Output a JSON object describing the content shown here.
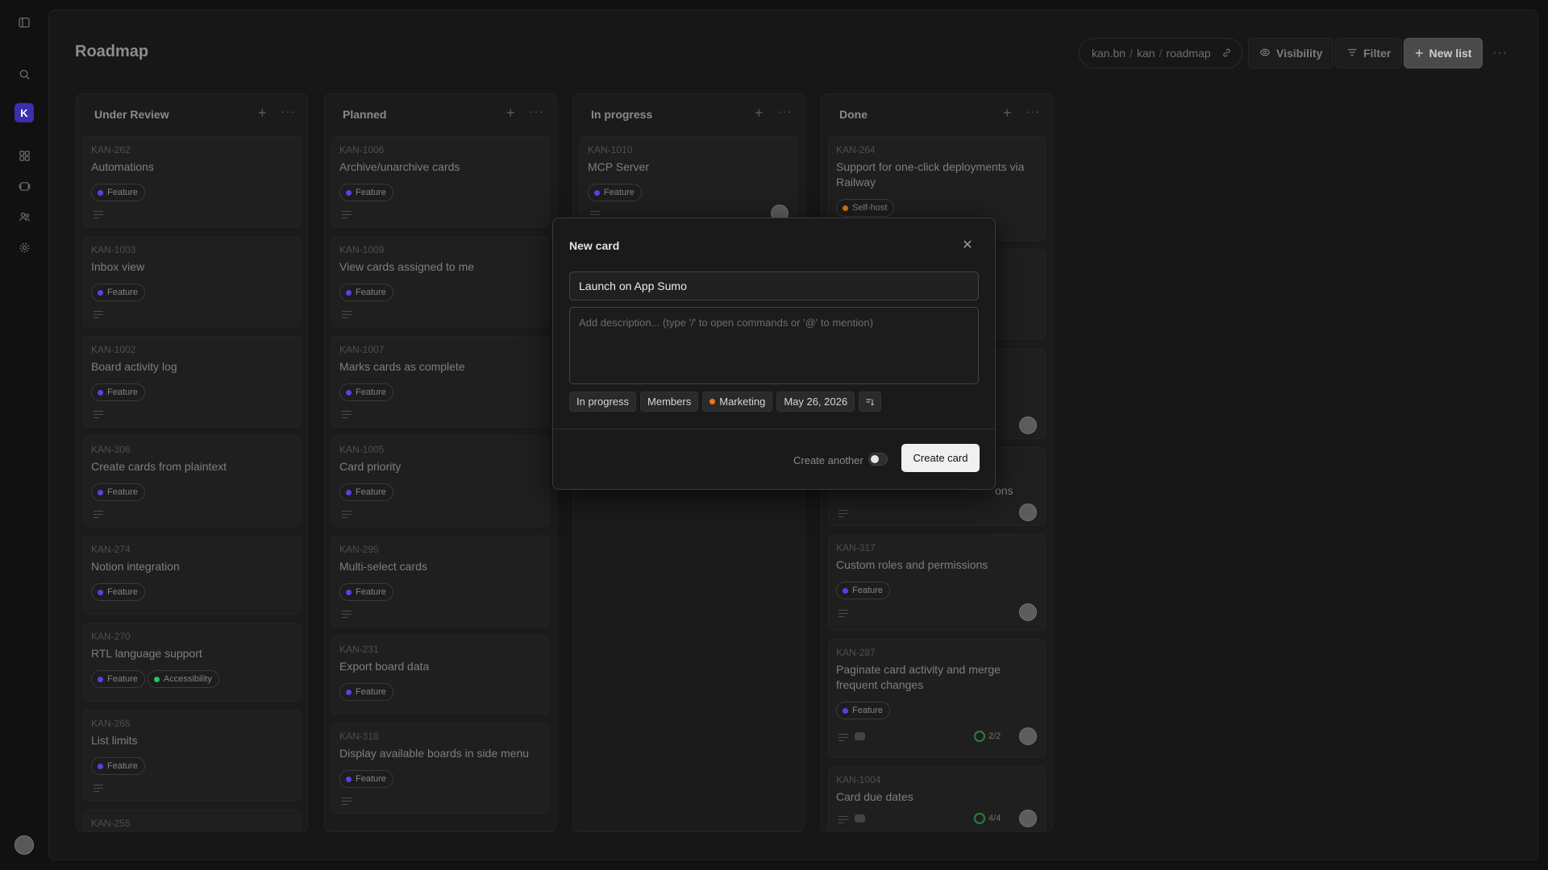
{
  "page": {
    "title": "Roadmap"
  },
  "breadcrumb": {
    "parts": [
      "kan.bn",
      "kan",
      "roadmap"
    ]
  },
  "toolbar": {
    "visibility": "Visibility",
    "filter": "Filter",
    "new_list": "New list"
  },
  "sidebar": {
    "workspace_initial": "K"
  },
  "label_colors": {
    "Feature": "#4f46e5",
    "Self-host": "#d97706",
    "Accessibility": "#22c55e",
    "Marketing": "#f97316"
  },
  "columns": [
    {
      "title": "Under Review",
      "cards": [
        {
          "id": "KAN-262",
          "title": "Automations",
          "labels": [
            "Feature"
          ]
        },
        {
          "id": "KAN-1003",
          "title": "Inbox view",
          "labels": [
            "Feature"
          ]
        },
        {
          "id": "KAN-1002",
          "title": "Board activity log",
          "labels": [
            "Feature"
          ]
        },
        {
          "id": "KAN-306",
          "title": "Create cards from plaintext",
          "labels": [
            "Feature"
          ]
        },
        {
          "id": "KAN-274",
          "title": "Notion integration",
          "labels": [
            "Feature"
          ]
        },
        {
          "id": "KAN-270",
          "title": "RTL language support",
          "labels": [
            "Feature",
            "Accessibility"
          ]
        },
        {
          "id": "KAN-265",
          "title": "List limits",
          "labels": [
            "Feature"
          ]
        },
        {
          "id": "KAN-255",
          "title": "",
          "labels": []
        }
      ]
    },
    {
      "title": "Planned",
      "cards": [
        {
          "id": "KAN-1006",
          "title": "Archive/unarchive cards",
          "labels": [
            "Feature"
          ]
        },
        {
          "id": "KAN-1009",
          "title": "View cards assigned to me",
          "labels": [
            "Feature"
          ]
        },
        {
          "id": "KAN-1007",
          "title": "Marks cards as complete",
          "labels": [
            "Feature"
          ]
        },
        {
          "id": "KAN-1005",
          "title": "Card priority",
          "labels": [
            "Feature"
          ]
        },
        {
          "id": "KAN-295",
          "title": "Multi-select cards",
          "labels": [
            "Feature"
          ]
        },
        {
          "id": "KAN-231",
          "title": "Export board data",
          "labels": [
            "Feature"
          ]
        },
        {
          "id": "KAN-318",
          "title": "Display available boards in side menu",
          "labels": [
            "Feature"
          ]
        }
      ]
    },
    {
      "title": "In progress",
      "cards": [
        {
          "id": "KAN-1010",
          "title": "MCP Server",
          "labels": [
            "Feature"
          ]
        }
      ]
    },
    {
      "title": "Done",
      "cards": [
        {
          "id": "KAN-264",
          "title": "Support for one-click deployments via Railway",
          "labels": [
            "Self-host"
          ]
        },
        {
          "id": "",
          "title": "",
          "labels": []
        },
        {
          "id": "",
          "title": "",
          "labels": []
        },
        {
          "id": "",
          "title": "ons",
          "labels": []
        },
        {
          "id": "KAN-317",
          "title": "Custom roles and permissions",
          "labels": [
            "Feature"
          ]
        },
        {
          "id": "KAN-287",
          "title": "Paginate card activity and merge frequent changes",
          "labels": [
            "Feature"
          ],
          "checklist": "2/2"
        },
        {
          "id": "KAN-1004",
          "title": "Card due dates",
          "labels": [],
          "checklist": "4/4"
        }
      ]
    }
  ],
  "modal": {
    "title": "New card",
    "title_value": "Launch on App Sumo",
    "description_placeholder": "Add description... (type '/' to open commands or '@' to mention)",
    "chips": {
      "list": "In progress",
      "members": "Members",
      "label": "Marketing",
      "due_date": "May 26, 2026"
    },
    "create_another": "Create another",
    "create_another_on": false,
    "create_button": "Create card"
  }
}
